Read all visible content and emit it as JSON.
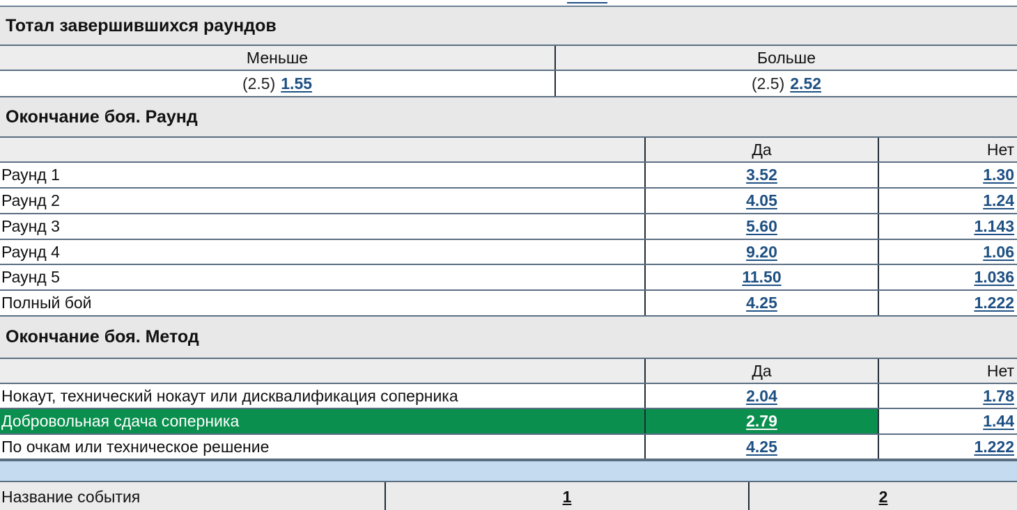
{
  "total_section": {
    "title": "Тотал завершившихся раундов",
    "col_under": "Меньше",
    "col_over": "Больше",
    "under_line": "(2.5)",
    "under_odds": "1.55",
    "over_line": "(2.5)",
    "over_odds": "2.52"
  },
  "round_section": {
    "title": "Окончание боя. Раунд",
    "col_yes": "Да",
    "col_no": "Нет",
    "rows": [
      {
        "label": "Раунд 1",
        "yes": "3.52",
        "no": "1.30"
      },
      {
        "label": "Раунд 2",
        "yes": "4.05",
        "no": "1.24"
      },
      {
        "label": "Раунд 3",
        "yes": "5.60",
        "no": "1.143"
      },
      {
        "label": "Раунд 4",
        "yes": "9.20",
        "no": "1.06"
      },
      {
        "label": "Раунд 5",
        "yes": "11.50",
        "no": "1.036"
      },
      {
        "label": "Полный бой",
        "yes": "4.25",
        "no": "1.222"
      }
    ]
  },
  "method_section": {
    "title": "Окончание боя. Метод",
    "col_yes": "Да",
    "col_no": "Нет",
    "rows": [
      {
        "label": "Нокаут, технический нокаут или дисквалификация соперника",
        "yes": "2.04",
        "no": "1.78"
      },
      {
        "label": "Добровольная сдача соперника",
        "yes": "2.79",
        "no": "1.44"
      },
      {
        "label": "По очкам или техническое решение",
        "yes": "4.25",
        "no": "1.222"
      }
    ],
    "highlight_color": "#0a8f4e"
  },
  "event_header": {
    "name_label": "Название события",
    "col_1": "1",
    "col_2": "2"
  },
  "colors": {
    "link": "#1d4f82",
    "header_bg": "#e8e8e8",
    "band_bg": "#c5dcf0"
  }
}
